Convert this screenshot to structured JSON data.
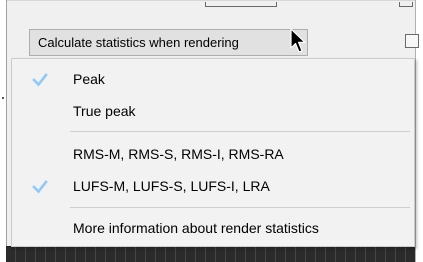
{
  "button": {
    "label": "Calculate statistics when rendering"
  },
  "menu": {
    "items": [
      {
        "label": "Peak",
        "checked": true
      },
      {
        "label": "True peak",
        "checked": false
      },
      {
        "label": "RMS-M, RMS-S, RMS-I, RMS-RA",
        "checked": false
      },
      {
        "label": "LUFS-M, LUFS-S, LUFS-I, LRA",
        "checked": true
      },
      {
        "label": "More information about render statistics",
        "checked": false
      }
    ]
  },
  "colors": {
    "check_accent": "#90c8f6",
    "menu_bg": "#f2f2f2",
    "button_bg": "#e1e1e1"
  }
}
